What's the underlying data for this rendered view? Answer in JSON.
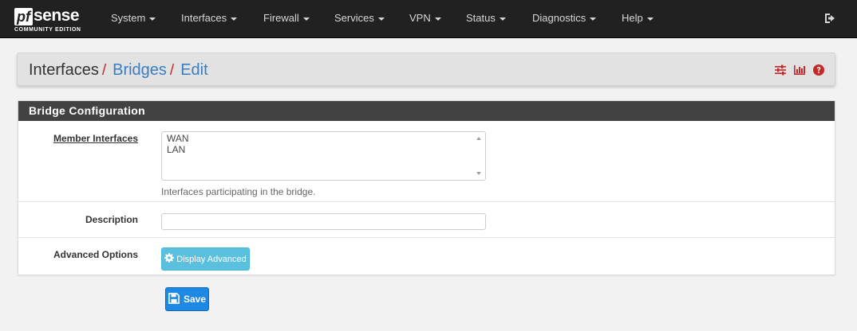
{
  "brand": {
    "logo_pf": "pf",
    "logo_sense": "sense",
    "edition": "COMMUNITY EDITION"
  },
  "nav": {
    "items": [
      {
        "label": "System"
      },
      {
        "label": "Interfaces"
      },
      {
        "label": "Firewall"
      },
      {
        "label": "Services"
      },
      {
        "label": "VPN"
      },
      {
        "label": "Status"
      },
      {
        "label": "Diagnostics"
      },
      {
        "label": "Help"
      }
    ],
    "logout_icon": "sign-out-icon"
  },
  "breadcrumb": {
    "items": [
      {
        "label": "Interfaces"
      },
      {
        "label": "Bridges"
      },
      {
        "label": "Edit"
      }
    ],
    "separator": "/",
    "icons": [
      "sliders-icon",
      "bar-chart-icon",
      "question-circle-icon"
    ]
  },
  "panel": {
    "title": "Bridge Configuration",
    "member_interfaces": {
      "label": "Member Interfaces",
      "options": [
        "WAN",
        "LAN"
      ],
      "help": "Interfaces participating in the bridge."
    },
    "description": {
      "label": "Description",
      "value": ""
    },
    "advanced": {
      "label": "Advanced Options",
      "button_label": "Display Advanced",
      "icon": "gear-icon"
    }
  },
  "save_button": {
    "label": "Save",
    "icon": "save-icon"
  },
  "colors": {
    "navbar": "#212121",
    "accent_red": "#c62828",
    "link_blue": "#3a7dc0",
    "info_button": "#5bc0de",
    "primary_button": "#1e88e5"
  }
}
